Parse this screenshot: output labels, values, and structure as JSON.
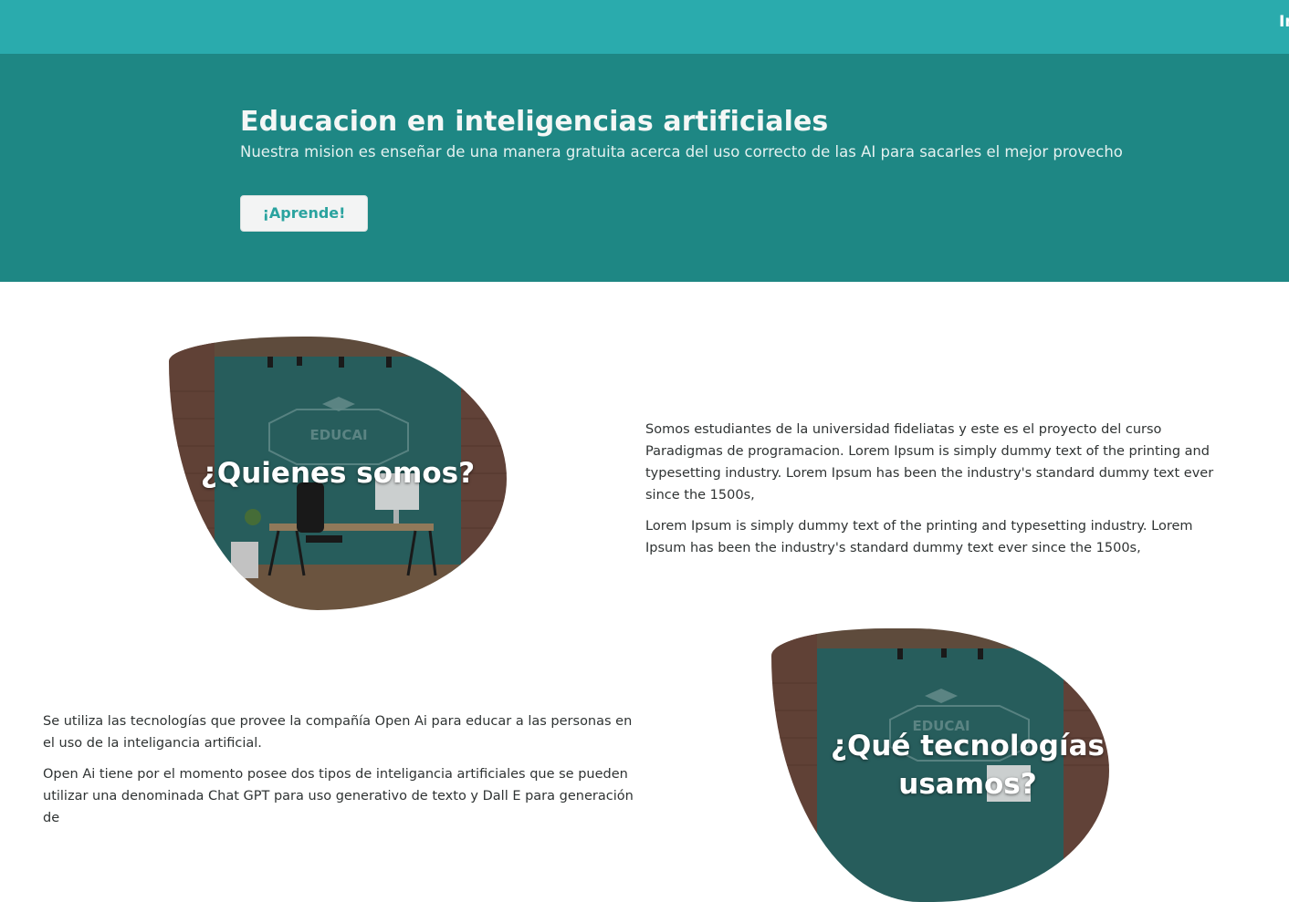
{
  "nav": {
    "link_label": "In"
  },
  "hero": {
    "title": "Educacion en inteligencias artificiales",
    "subtitle": "Nuestra mision es enseñar de una manera gratuita acerca del uso correcto de las AI para sacarles el mejor provecho",
    "button_label": "¡Aprende!"
  },
  "about": {
    "heading": "¿Quienes somos?",
    "image_logo_text": "EDUCAI",
    "paragraphs": [
      "Somos estudiantes de la universidad fideliatas y este es el proyecto del curso Paradigmas de programacion. Lorem Ipsum is simply dummy text of the printing and typesetting industry. Lorem Ipsum has been the industry's standard dummy text ever since the 1500s,",
      "Lorem Ipsum is simply dummy text of the printing and typesetting industry. Lorem Ipsum has been the industry's standard dummy text ever since the 1500s,"
    ]
  },
  "tech": {
    "heading": "¿Qué tecnologías usamos?",
    "image_logo_text": "EDUCAI",
    "paragraphs": [
      "Se utiliza las tecnologías que provee la compañía Open Ai para educar a las personas en el uso de la inteligancia artificial.",
      "Open Ai tiene por el momento posee dos tipos de inteligancia artificiales que se pueden utilizar una denominada Chat GPT para uso generativo de texto y Dall E para generación de"
    ]
  },
  "colors": {
    "nav_bg": "#2aabad",
    "hero_bg": "#1e8784",
    "accent": "#2aa39f"
  }
}
